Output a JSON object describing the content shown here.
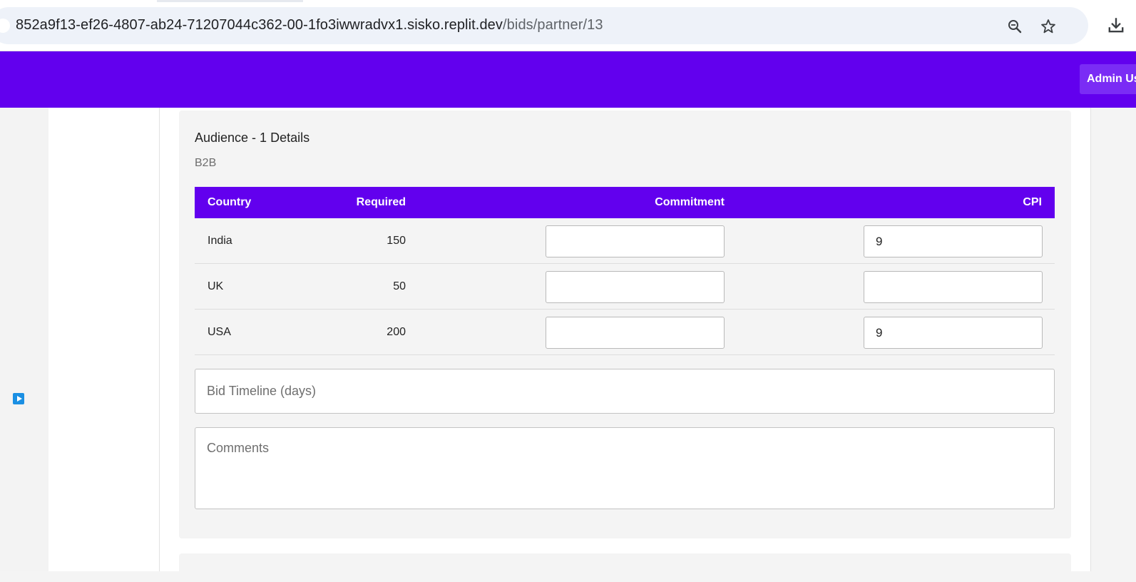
{
  "browser": {
    "url_host": "852a9f13-ef26-4807-ab24-71207044c362-00-1fo3iwwradvx1.sisko.replit.dev",
    "url_path": "/bids/partner/13"
  },
  "header": {
    "admin_label": "Admin Us",
    "accent_color": "#6200ee"
  },
  "audience": {
    "title": "Audience - 1 Details",
    "subtitle": "B2B",
    "columns": {
      "country": "Country",
      "required": "Required",
      "commitment": "Commitment",
      "cpi": "CPI"
    },
    "rows": [
      {
        "country": "India",
        "required": "150",
        "commitment": "",
        "cpi": "9"
      },
      {
        "country": "UK",
        "required": "50",
        "commitment": "",
        "cpi": ""
      },
      {
        "country": "USA",
        "required": "200",
        "commitment": "",
        "cpi": "9"
      }
    ],
    "timeline_placeholder": "Bid Timeline (days)",
    "comments_placeholder": "Comments"
  },
  "icons": {
    "zoom": "zoom-icon",
    "bookmark": "star-icon",
    "download": "download-icon",
    "side_play": "play-icon"
  }
}
